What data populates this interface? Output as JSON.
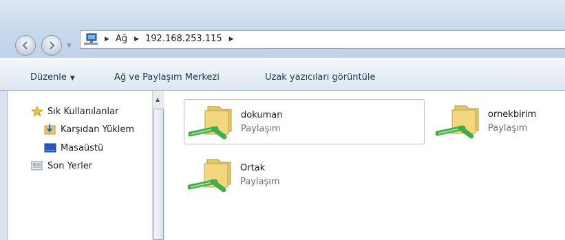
{
  "nav": {
    "breadcrumbs": [
      "Ağ",
      "192.168.253.115"
    ]
  },
  "toolbar": {
    "organize_label": "Düzenle",
    "network_center_label": "Ağ ve Paylaşım Merkezi",
    "remote_printers_label": "Uzak yazıcıları görüntüle"
  },
  "sidebar": {
    "items": [
      {
        "label": "Sık Kullanılanlar",
        "icon": "star-icon"
      },
      {
        "label": "Karşıdan Yüklem",
        "icon": "downloads-icon"
      },
      {
        "label": "Masaüstü",
        "icon": "desktop-icon"
      },
      {
        "label": "Son Yerler",
        "icon": "recent-places-icon"
      }
    ]
  },
  "shares": [
    {
      "name": "dokuman",
      "type": "Paylaşım",
      "selected": true
    },
    {
      "name": "ornekbirim",
      "type": "Paylaşım",
      "selected": false
    },
    {
      "name": "Ortak",
      "type": "Paylaşım",
      "selected": false
    }
  ],
  "colors": {
    "folder": "#f2d77e",
    "cable": "#3fae48",
    "selection_border": "#aac0d8"
  }
}
